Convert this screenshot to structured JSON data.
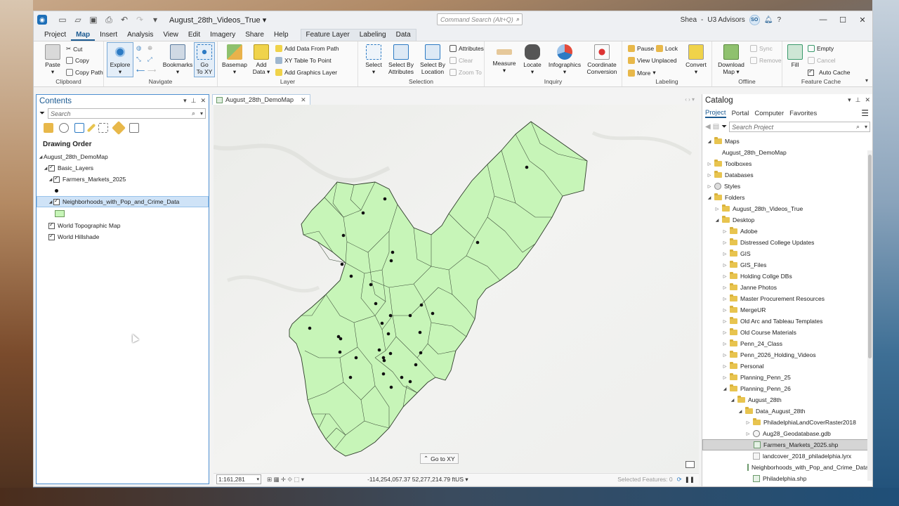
{
  "titlebar": {
    "project": "August_28th_Videos_True",
    "command_search_placeholder": "Command Search (Alt+Q)",
    "user": "Shea",
    "org": "U3 Advisors",
    "initials": "SO",
    "help": "?"
  },
  "ribbon_tabs": [
    "Project",
    "Map",
    "Insert",
    "Analysis",
    "View",
    "Edit",
    "Imagery",
    "Share",
    "Help"
  ],
  "active_tab": "Map",
  "context_tabs": [
    "Feature Layer",
    "Labeling",
    "Data"
  ],
  "ribbon": {
    "clipboard": {
      "label": "Clipboard",
      "paste": "Paste",
      "cut": "Cut",
      "copy": "Copy",
      "copy_path": "Copy Path"
    },
    "navigate": {
      "label": "Navigate",
      "explore": "Explore",
      "bookmarks": "Bookmarks",
      "go_to_xy_1": "Go",
      "go_to_xy_2": "To XY"
    },
    "layer": {
      "label": "Layer",
      "basemap": "Basemap",
      "add_data_1": "Add",
      "add_data_2": "Data",
      "add_data_from_path": "Add Data From Path",
      "xy_table": "XY Table To Point",
      "add_graphics": "Add Graphics Layer"
    },
    "selection": {
      "label": "Selection",
      "select": "Select",
      "select_by_attr_1": "Select By",
      "select_by_attr_2": "Attributes",
      "select_by_loc_1": "Select By",
      "select_by_loc_2": "Location",
      "attributes": "Attributes",
      "clear": "Clear",
      "zoom_to": "Zoom To"
    },
    "inquiry": {
      "label": "Inquiry",
      "measure": "Measure",
      "locate": "Locate",
      "infographics": "Infographics",
      "coord_1": "Coordinate",
      "coord_2": "Conversion"
    },
    "labeling": {
      "label": "Labeling",
      "pause": "Pause",
      "lock": "Lock",
      "view_unplaced": "View Unplaced",
      "more": "More",
      "convert": "Convert"
    },
    "offline": {
      "label": "Offline",
      "download_1": "Download",
      "download_2": "Map",
      "sync": "Sync",
      "remove": "Remove"
    },
    "feature_cache": {
      "label": "Feature Cache",
      "fill": "Fill",
      "empty": "Empty",
      "cancel": "Cancel",
      "auto_cache": "Auto Cache"
    }
  },
  "contents": {
    "title": "Contents",
    "search_placeholder": "Search",
    "drawing_order": "Drawing Order",
    "tree": [
      {
        "label": "August_28th_DemoMap",
        "level": 0
      },
      {
        "label": "Basic_Layers",
        "level": 1
      },
      {
        "label": "Farmers_Markets_2025",
        "level": 2
      },
      {
        "label": "Neighborhoods_with_Pop_and_Crime_Data",
        "level": 2
      },
      {
        "label": "World Topographic Map",
        "level": 1
      },
      {
        "label": "World Hillshade",
        "level": 1
      }
    ]
  },
  "map_view": {
    "tab": "August_28th_DemoMap",
    "go_to_xy": "Go to XY",
    "scale": "1:161,281",
    "coordinates": "-114,254,057.37 52,277,214.79 ftUS",
    "selected_features": "Selected Features: 0",
    "fill_color": "#c7f5b8",
    "point_color": "#111111"
  },
  "catalog": {
    "title": "Catalog",
    "tabs": [
      "Project",
      "Portal",
      "Computer",
      "Favorites"
    ],
    "active_tab": "Project",
    "search_placeholder": "Search Project",
    "items": [
      {
        "label": "Maps",
        "level": 0,
        "icon": "folder",
        "open": true
      },
      {
        "label": "August_28th_DemoMap",
        "level": 1,
        "icon": "map"
      },
      {
        "label": "Toolboxes",
        "level": 0,
        "icon": "folder"
      },
      {
        "label": "Databases",
        "level": 0,
        "icon": "folder"
      },
      {
        "label": "Styles",
        "level": 0,
        "icon": "gear"
      },
      {
        "label": "Folders",
        "level": 0,
        "icon": "folder",
        "open": true
      },
      {
        "label": "August_28th_Videos_True",
        "level": 1,
        "icon": "folder"
      },
      {
        "label": "Desktop",
        "level": 1,
        "icon": "folder",
        "open": true
      },
      {
        "label": "Adobe",
        "level": 2,
        "icon": "folder"
      },
      {
        "label": "Distressed College Updates",
        "level": 2,
        "icon": "folder"
      },
      {
        "label": "GIS",
        "level": 2,
        "icon": "folder"
      },
      {
        "label": "GIS_Files",
        "level": 2,
        "icon": "folder"
      },
      {
        "label": "Holding Collge DBs",
        "level": 2,
        "icon": "folder"
      },
      {
        "label": "Janne Photos",
        "level": 2,
        "icon": "folder"
      },
      {
        "label": "Master Procurement Resources",
        "level": 2,
        "icon": "folder"
      },
      {
        "label": "MergeUR",
        "level": 2,
        "icon": "folder"
      },
      {
        "label": "Old Arc and Tableau Templates",
        "level": 2,
        "icon": "folder"
      },
      {
        "label": "Old Course Materials",
        "level": 2,
        "icon": "folder"
      },
      {
        "label": "Penn_24_Class",
        "level": 2,
        "icon": "folder"
      },
      {
        "label": "Penn_2026_Holding_Videos",
        "level": 2,
        "icon": "folder"
      },
      {
        "label": "Personal",
        "level": 2,
        "icon": "folder"
      },
      {
        "label": "Planning_Penn_25",
        "level": 2,
        "icon": "folder"
      },
      {
        "label": "Planning_Penn_26",
        "level": 2,
        "icon": "folder",
        "open": true
      },
      {
        "label": "August_28th",
        "level": 3,
        "icon": "folder",
        "open": true
      },
      {
        "label": "Data_August_28th",
        "level": 4,
        "icon": "folder",
        "open": true
      },
      {
        "label": "PhiladelphiaLandCoverRaster2018",
        "level": 5,
        "icon": "folder"
      },
      {
        "label": "Aug28_Geodatabase.gdb",
        "level": 5,
        "icon": "gdb"
      },
      {
        "label": "Farmers_Markets_2025.shp",
        "level": 5,
        "icon": "shp",
        "selected": true
      },
      {
        "label": "landcover_2018_philadelphia.lyrx",
        "level": 5,
        "icon": "lyr"
      },
      {
        "label": "Neighborhoods_with_Pop_and_Crime_Data.shp",
        "level": 5,
        "icon": "shp"
      },
      {
        "label": "Philadelphia.shp",
        "level": 5,
        "icon": "shp"
      }
    ]
  }
}
